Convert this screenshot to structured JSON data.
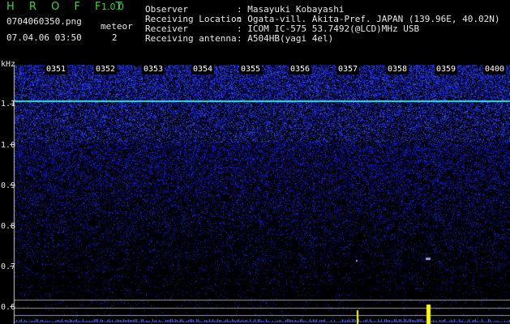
{
  "app": {
    "name": "H R O F F T",
    "version": "1.0.0"
  },
  "file": {
    "name": "0704060350.png",
    "datetime": "07.04.06 03:50"
  },
  "meteor": {
    "label": "meteor",
    "count": "2"
  },
  "info": [
    {
      "label": "Observer",
      "value": ": Masayuki Kobayashi"
    },
    {
      "label": "Receiving Location",
      "value": ": Ogata-vill. Akita-Pref. JAPAN (139.96E, 40.02N)"
    },
    {
      "label": "Receiver",
      "value": ": ICOM IC-575 53.7492(@LCD)MHz USB"
    },
    {
      "label": "Receiving antenna",
      "value": ": A504HB(yagi 4el)"
    }
  ],
  "y_axis": {
    "unit": "kHz",
    "ticks": [
      "1.1",
      "1.0",
      "0.9",
      "0.8",
      "0.7",
      "0.6"
    ]
  },
  "time_labels": [
    "0351",
    "0352",
    "0353",
    "0354",
    "0355",
    "0356",
    "0357",
    "0358",
    "0359",
    "0400"
  ],
  "colors": {
    "accent": "#3fd63f",
    "carrier": "#38e0e0",
    "meteor_ping": "#ffff00",
    "noise": "#2d3fff"
  }
}
